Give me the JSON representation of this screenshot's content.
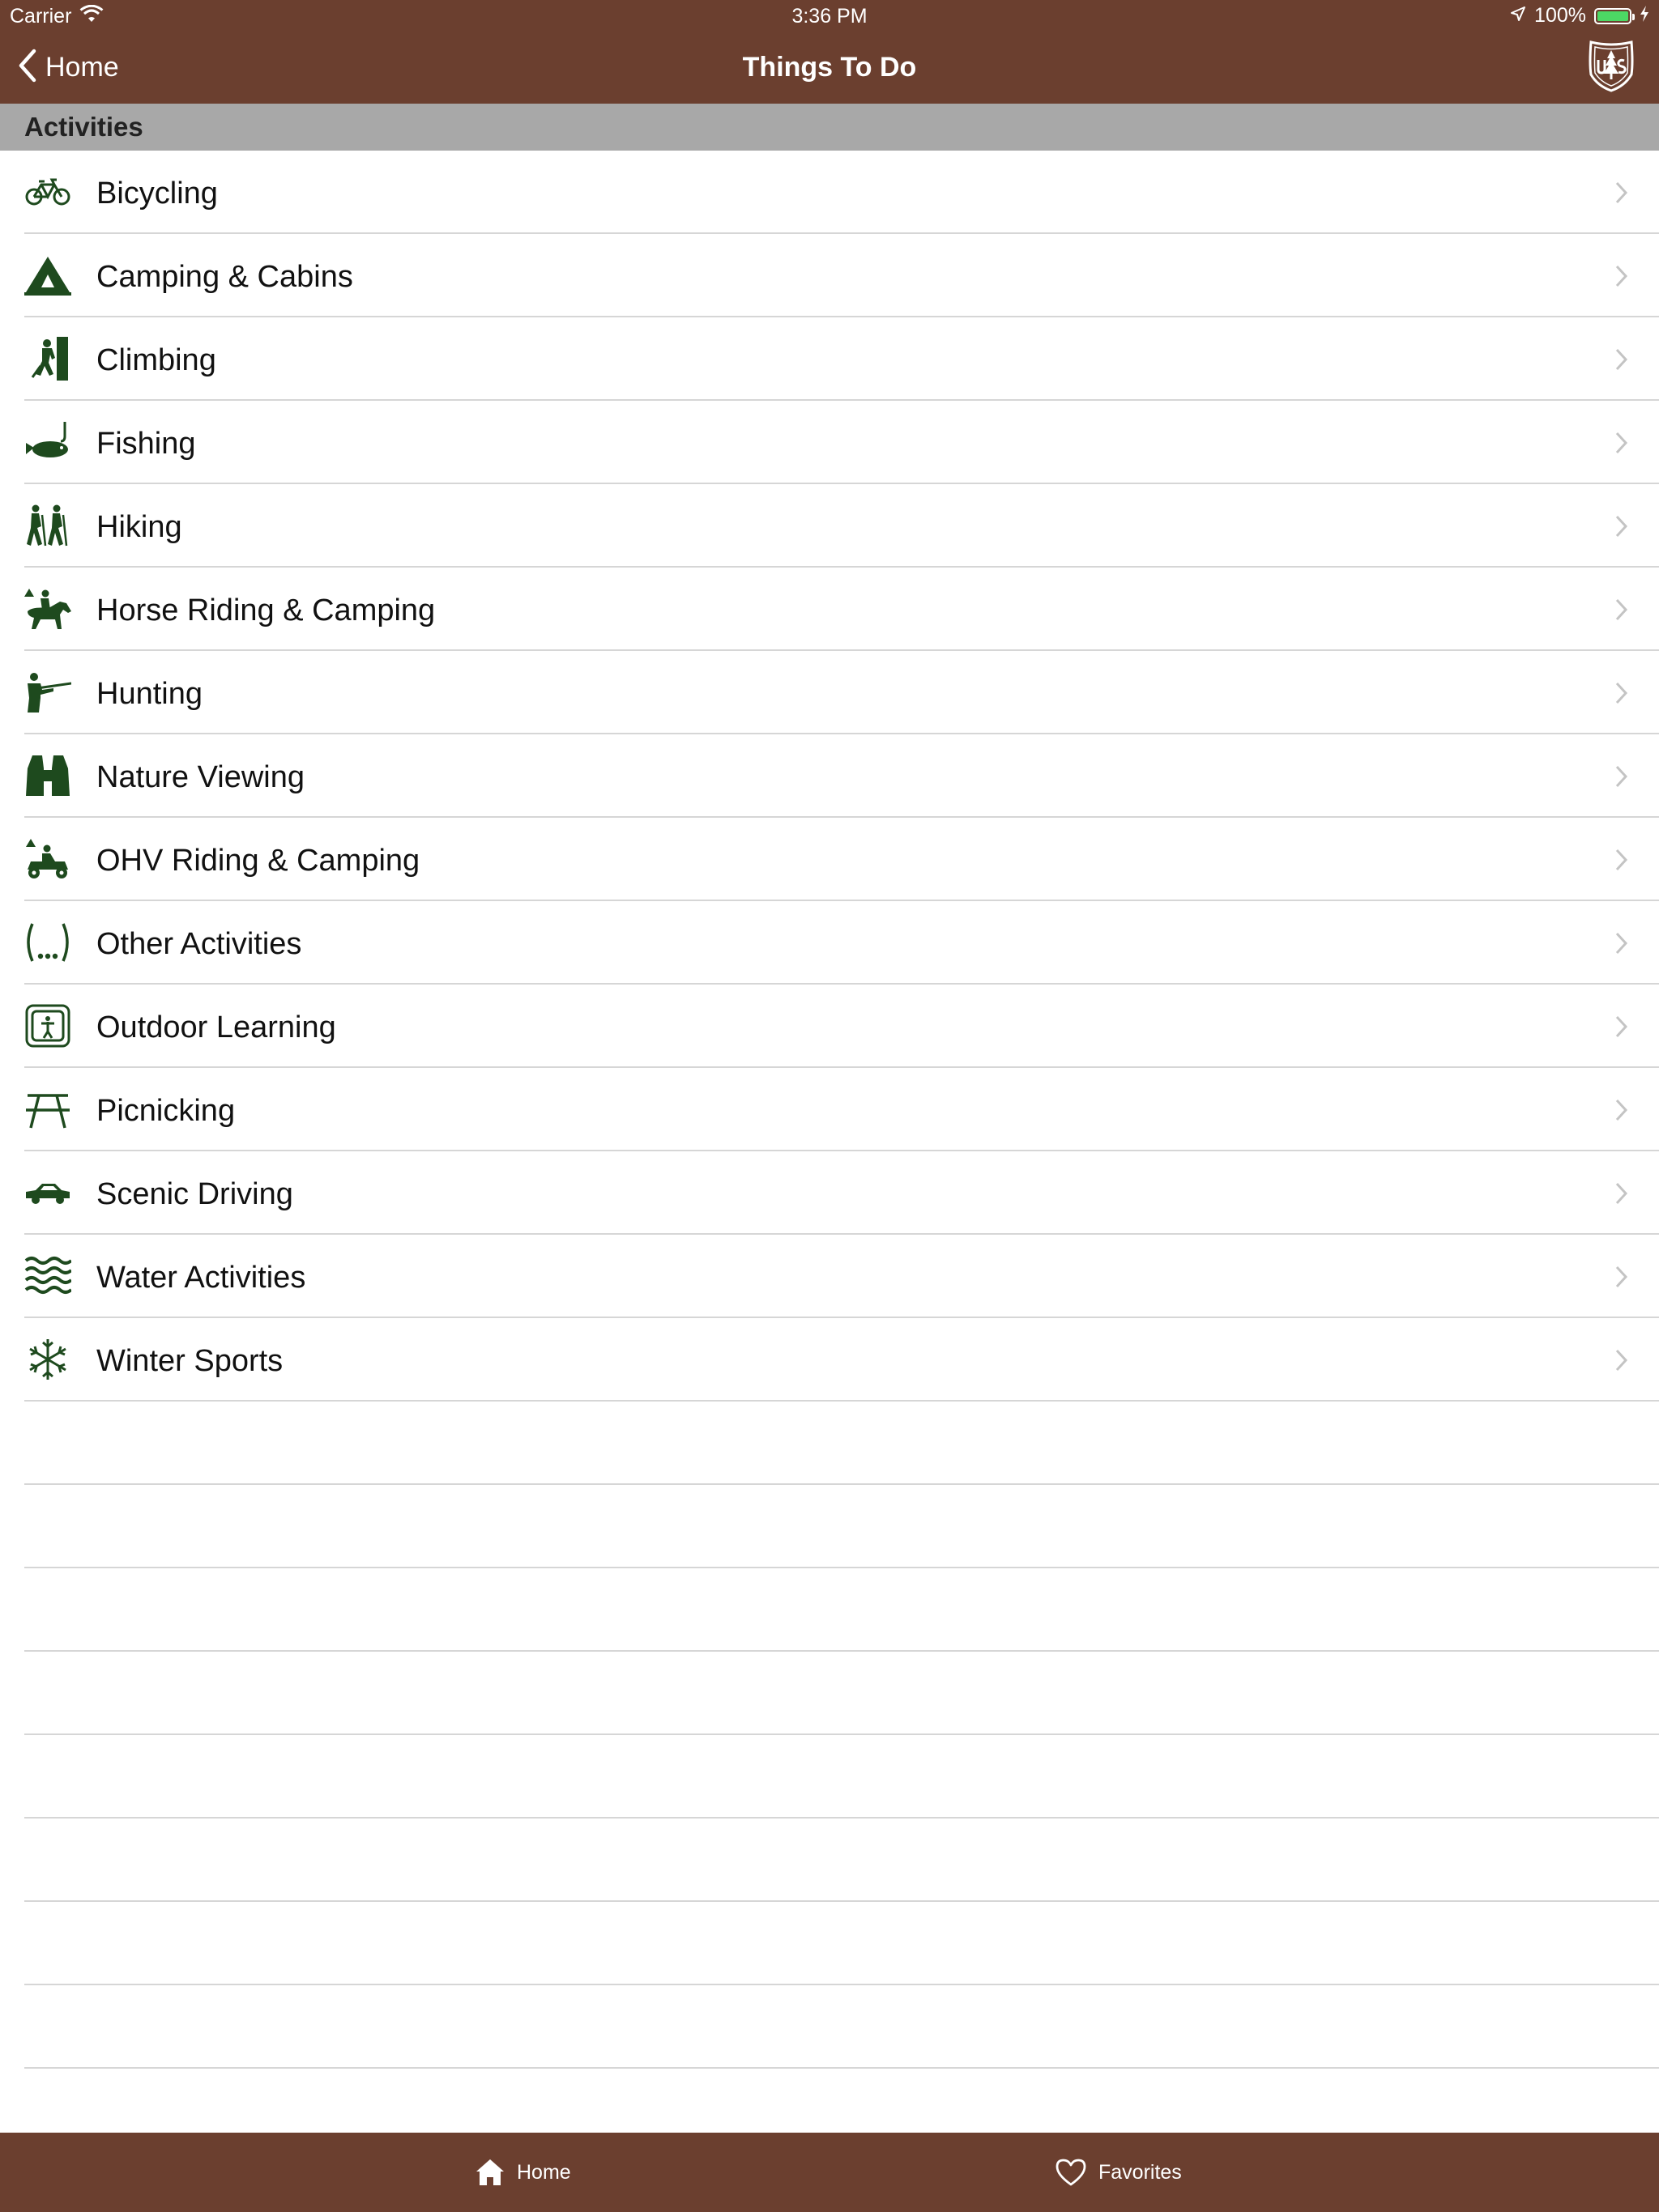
{
  "status_bar": {
    "carrier": "Carrier",
    "time": "3:36 PM",
    "battery_percent": "100%",
    "battery_level": 1.0,
    "icons": [
      "wifi-icon",
      "location-arrow-icon",
      "battery-icon",
      "charging-bolt-icon"
    ]
  },
  "nav_bar": {
    "back_label": "Home",
    "title": "Things To Do",
    "logo_icon": "forest-service-shield-icon"
  },
  "section": {
    "title": "Activities"
  },
  "activities": [
    {
      "label": "Bicycling",
      "icon": "bicycle-icon"
    },
    {
      "label": "Camping & Cabins",
      "icon": "tent-icon"
    },
    {
      "label": "Climbing",
      "icon": "climbing-icon"
    },
    {
      "label": "Fishing",
      "icon": "fish-icon"
    },
    {
      "label": "Hiking",
      "icon": "hikers-icon"
    },
    {
      "label": "Horse Riding & Camping",
      "icon": "horse-rider-icon"
    },
    {
      "label": "Hunting",
      "icon": "hunter-icon"
    },
    {
      "label": "Nature Viewing",
      "icon": "binoculars-icon"
    },
    {
      "label": "OHV Riding & Camping",
      "icon": "atv-icon"
    },
    {
      "label": "Other Activities",
      "icon": "ellipsis-parentheses-icon"
    },
    {
      "label": "Outdoor Learning",
      "icon": "interpretive-sign-icon"
    },
    {
      "label": "Picnicking",
      "icon": "picnic-table-icon"
    },
    {
      "label": "Scenic Driving",
      "icon": "car-icon"
    },
    {
      "label": "Water Activities",
      "icon": "waves-icon"
    },
    {
      "label": "Winter Sports",
      "icon": "snowflake-icon"
    }
  ],
  "tab_bar": {
    "home_label": "Home",
    "home_icon": "house-icon",
    "favorites_label": "Favorites",
    "favorites_icon": "heart-icon"
  },
  "colors": {
    "brand_brown": "#6b3f2f",
    "icon_green": "#1e4a1e",
    "section_gray": "#a8a8a8",
    "separator": "#d6d6d6",
    "chevron": "#c4c4c4",
    "battery_green": "#4cd964"
  }
}
